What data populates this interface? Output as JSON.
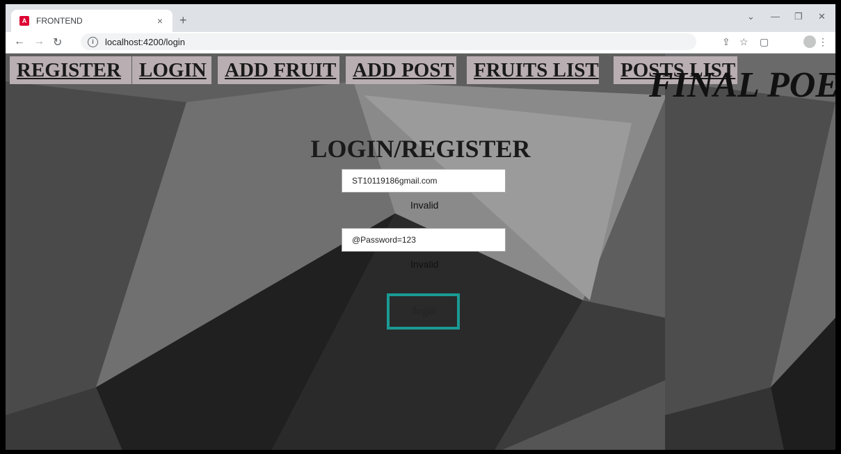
{
  "browser": {
    "tab_title": "FRONTEND",
    "tab_favicon": "angular-icon",
    "tab_close": "×",
    "new_tab": "+",
    "url": "localhost:4200/login",
    "window_controls": [
      "⌄",
      "—",
      "❐",
      "✕"
    ]
  },
  "nav": {
    "items": [
      "REGISTER",
      "LOGIN",
      "ADD FRUIT",
      "ADD POST",
      "FRUITS LIST",
      "POSTS LIST"
    ]
  },
  "banner": "FINAL POE",
  "form": {
    "heading": "LOGIN/REGISTER",
    "email_value": "ST10119186gmail.com",
    "email_error": "Invalid",
    "password_value": "@Password=123",
    "password_error": "Invalid",
    "submit_label": "/login"
  },
  "colors": {
    "nav_bg": "#b9aeb1",
    "button_border": "#1a9a94"
  }
}
